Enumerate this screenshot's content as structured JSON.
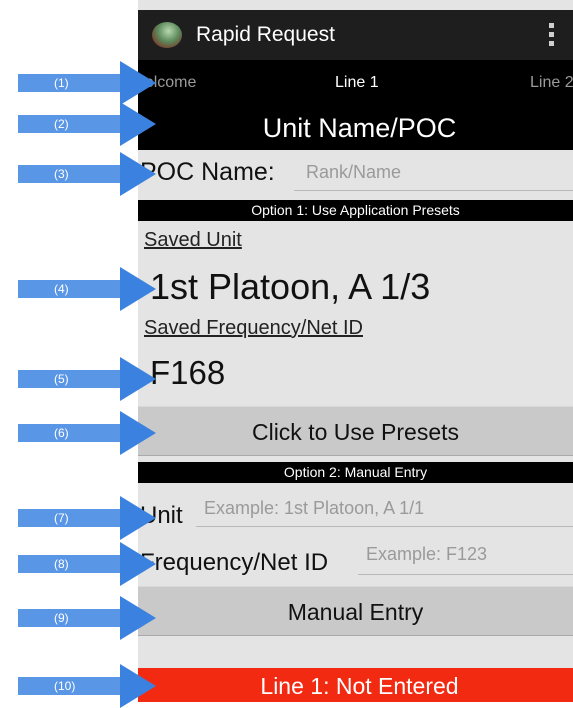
{
  "app": {
    "title": "Rapid Request",
    "icon": "app-globe-icon",
    "menu_icon": "overflow-menu-icon"
  },
  "tabs": [
    {
      "label": "Welcome"
    },
    {
      "label": "Line 1"
    },
    {
      "label": "Line 2"
    }
  ],
  "header": {
    "title": "Unit Name/POC"
  },
  "poc": {
    "label": "POC Name:",
    "placeholder": "Rank/Name"
  },
  "option1": {
    "title": "Option 1: Use Application Presets",
    "saved_unit_label": "Saved Unit",
    "saved_unit_value": "1st Platoon, A 1/3",
    "saved_freq_label": "Saved Frequency/Net ID",
    "saved_freq_value": "F168",
    "button": "Click to Use Presets"
  },
  "option2": {
    "title": "Option 2: Manual Entry",
    "unit_label": "Unit",
    "unit_placeholder": "Example: 1st Platoon, A 1/1",
    "freq_label": "Frequency/Net ID",
    "freq_placeholder": "Example: F123",
    "button": "Manual Entry"
  },
  "status": {
    "text": "Line 1: Not Entered",
    "color": "#f22a12"
  },
  "callouts": [
    "(1)",
    "(2)",
    "(3)",
    "(4)",
    "(5)",
    "(6)",
    "(7)",
    "(8)",
    "(9)",
    "(10)"
  ],
  "colors": {
    "callout": "#3b82e0",
    "status_bar": "#f22a12",
    "header_bg": "#000000"
  }
}
